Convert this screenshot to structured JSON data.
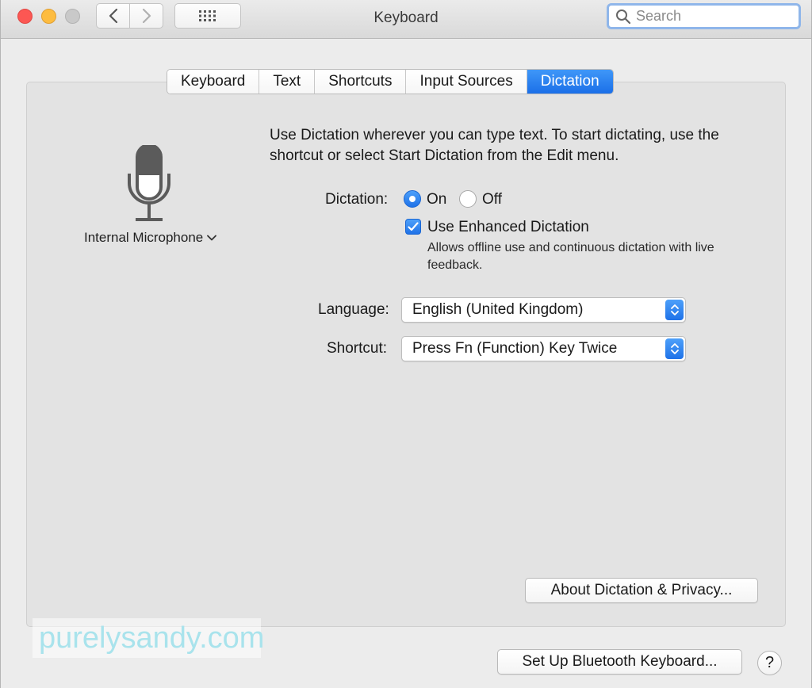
{
  "window": {
    "title": "Keyboard"
  },
  "toolbar": {
    "back_icon": "chevron-left-icon",
    "forward_icon": "chevron-right-icon",
    "grid_icon": "grid-icon"
  },
  "search": {
    "placeholder": "Search"
  },
  "tabs": [
    {
      "label": "Keyboard",
      "active": false
    },
    {
      "label": "Text",
      "active": false
    },
    {
      "label": "Shortcuts",
      "active": false
    },
    {
      "label": "Input Sources",
      "active": false
    },
    {
      "label": "Dictation",
      "active": true
    }
  ],
  "dictation": {
    "microphone_label": "Internal Microphone",
    "intro": "Use Dictation wherever you can type text. To start dictating, use the shortcut or select Start Dictation from the Edit menu.",
    "dictation_label": "Dictation:",
    "on_label": "On",
    "off_label": "Off",
    "selected": "On",
    "enhanced_label": "Use Enhanced Dictation",
    "enhanced_checked": true,
    "enhanced_hint": "Allows offline use and continuous dictation with live feedback.",
    "language_label": "Language:",
    "language_value": "English (United Kingdom)",
    "shortcut_label": "Shortcut:",
    "shortcut_value": "Press Fn (Function) Key Twice",
    "about_button": "About Dictation & Privacy..."
  },
  "footer": {
    "bluetooth_button": "Set Up Bluetooth Keyboard...",
    "help_label": "?"
  },
  "watermark": "purelysandy.com",
  "colors": {
    "accent": "#1f72e8",
    "close": "#fc5753",
    "minimize": "#fdbc40",
    "zoom_disabled": "#c9c9c9"
  }
}
